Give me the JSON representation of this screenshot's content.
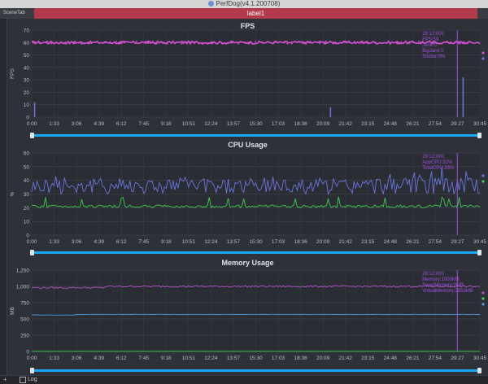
{
  "window": {
    "title": "PerfDog(v4.1.200708)"
  },
  "tabs": {
    "scene_tab": "SceneTab",
    "label_tab": "label1"
  },
  "statusbar": {
    "add": "+",
    "log_label": "Log"
  },
  "time_ticks": [
    "0:00",
    "1:33",
    "3:06",
    "4:39",
    "6:12",
    "7:45",
    "9:18",
    "10:51",
    "12:24",
    "13:57",
    "15:30",
    "17:03",
    "18:36",
    "20:09",
    "21:42",
    "23:15",
    "24:48",
    "26:21",
    "27:54",
    "29:27",
    "30:45"
  ],
  "colors": {
    "magenta": "#d44fd2",
    "violet": "#9f4fe0",
    "blue": "#6a76e0",
    "green": "#3fcf4e",
    "slider": "#1aa8ff"
  },
  "chart_data": [
    {
      "type": "line",
      "title": "FPS",
      "ylabel": "FPS",
      "ylim": [
        0,
        70
      ],
      "yticks": [
        "70",
        "60",
        "50",
        "40",
        "30",
        "20",
        "10",
        "0"
      ],
      "grid": true,
      "legend_location": "right",
      "series": [
        {
          "name": "",
          "approx_level": 60,
          "color": "#d44fd2"
        },
        {
          "name": "",
          "color": "#6a76e0",
          "spikes": [
            [
              0.2,
              12
            ],
            [
              20.5,
              8
            ],
            [
              29.6,
              32
            ]
          ]
        }
      ],
      "cursor": {
        "time": "29:12",
        "lines": [
          "29:12:000",
          "FPS:59",
          "Jank:0",
          "BigJank:0",
          "Stutter:0%"
        ]
      }
    },
    {
      "type": "line",
      "title": "CPU Usage",
      "ylabel": "%",
      "ylim": [
        0,
        60
      ],
      "yticks": [
        "60",
        "50",
        "40",
        "30",
        "20",
        "10",
        "0"
      ],
      "grid": true,
      "legend_location": "right",
      "series": [
        {
          "name": "",
          "approx_level": 36,
          "color": "#6a76e0"
        },
        {
          "name": "",
          "approx_level": 21,
          "color": "#3fcf4e"
        }
      ],
      "cursor": {
        "time": "29:12",
        "lines": [
          "29:12:000",
          "AppCPU:32%",
          "TotalCPU:33%"
        ]
      }
    },
    {
      "type": "line",
      "title": "Memory Usage",
      "ylabel": "MB",
      "ylim": [
        0,
        1250
      ],
      "yticks": [
        "1,250",
        "1,000",
        "750",
        "500",
        "250",
        "0"
      ],
      "grid": true,
      "legend_location": "right",
      "series": [
        {
          "name": "",
          "approx_level": 980,
          "color": "#b24fc6"
        },
        {
          "name": "",
          "approx_level": 3,
          "color": "#3fcf4e"
        },
        {
          "name": "",
          "approx_level": 560,
          "color": "#4c9be0"
        }
      ],
      "cursor": {
        "time": "29:12",
        "lines": [
          "29:12:000",
          "Memory:1000MB",
          "SwapMemory:0MB",
          "VirtualMemory:2853MB"
        ]
      }
    }
  ]
}
